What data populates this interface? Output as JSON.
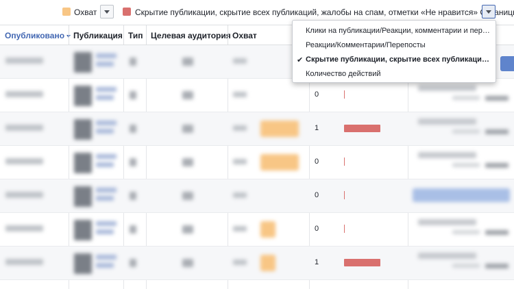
{
  "legend": {
    "reach_label": "Охват",
    "reach_color": "#f8c685",
    "negative_label": "Скрытие публикации, скрытие всех публикаций, жалобы на спам, отметки «Не нравится» Страницы",
    "negative_color": "#d9706e"
  },
  "table": {
    "columns": [
      "Опубликовано",
      "Публикация",
      "Тип",
      "Целевая аудитория",
      "Охват"
    ]
  },
  "rows": [
    {
      "negative_value": "",
      "reach_fill": 0,
      "negative_fill": 0
    },
    {
      "negative_value": "0",
      "reach_fill": 0,
      "negative_fill": 0
    },
    {
      "negative_value": "1",
      "reach_fill": 1,
      "negative_fill": 1
    },
    {
      "negative_value": "0",
      "reach_fill": 1,
      "negative_fill": 0
    },
    {
      "negative_value": "0",
      "reach_fill": 0,
      "negative_fill": 0
    },
    {
      "negative_value": "0",
      "reach_fill": 0.4,
      "negative_fill": 0
    },
    {
      "negative_value": "1",
      "reach_fill": 0.4,
      "negative_fill": 1
    }
  ],
  "menu": {
    "items": [
      {
        "label": "Клики на публикации/Реакции, комментарии и перепосты",
        "selected": false
      },
      {
        "label": "Реакции/Комментарии/Перепосты",
        "selected": false
      },
      {
        "label": "Скрытие публикации, скрытие всех публикаций, жалобы на спам, отметки «Не нравится» Страницы",
        "selected": true
      },
      {
        "label": "Количество действий",
        "selected": false
      }
    ],
    "check_glyph": "✔"
  }
}
